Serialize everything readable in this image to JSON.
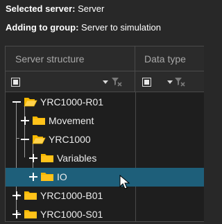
{
  "info": {
    "server_label": "Selected server:",
    "server_value": "Server",
    "group_label": "Adding to group:",
    "group_value": "Server to simulation"
  },
  "grid": {
    "columns": [
      "Server structure",
      "Data type"
    ]
  },
  "tree": [
    {
      "label": "YRC1000-R01",
      "level": 0,
      "expanded": true,
      "folder": "open",
      "selected": false
    },
    {
      "label": "Movement",
      "level": 1,
      "expanded": false,
      "folder": "closed",
      "selected": false
    },
    {
      "label": "YRC1000",
      "level": 1,
      "expanded": true,
      "folder": "open",
      "selected": false
    },
    {
      "label": "Variables",
      "level": 2,
      "expanded": false,
      "folder": "closed",
      "selected": false
    },
    {
      "label": "IO",
      "level": 2,
      "expanded": false,
      "folder": "closed",
      "selected": true
    },
    {
      "label": "YRC1000-B01",
      "level": 0,
      "expanded": false,
      "folder": "closed",
      "selected": false
    },
    {
      "label": "YRC1000-S01",
      "level": 0,
      "expanded": false,
      "folder": "closed",
      "selected": false
    }
  ],
  "colors": {
    "background": "#282828",
    "grid_background": "#1e1e1e",
    "selection": "#1e5f7a",
    "folder": "#f5b700"
  }
}
